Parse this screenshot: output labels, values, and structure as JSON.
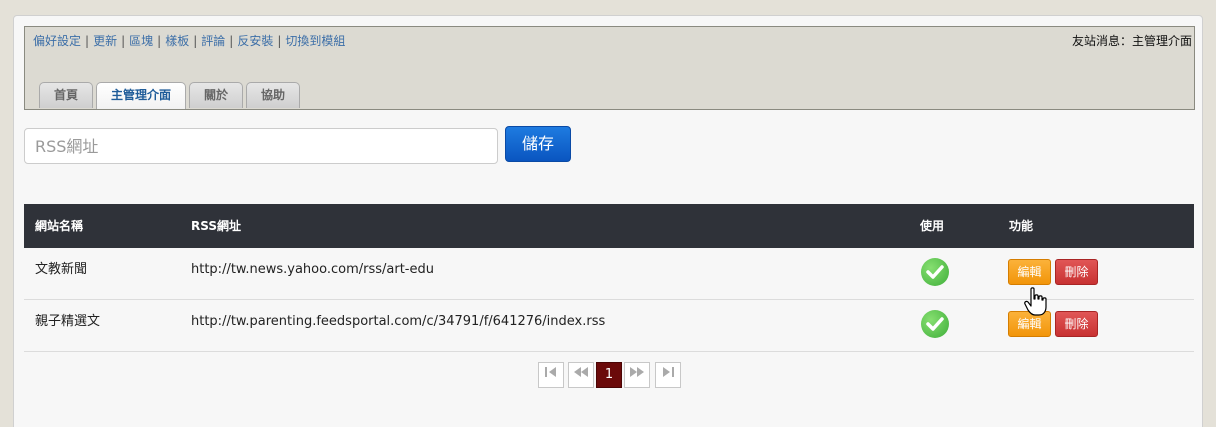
{
  "top_links": [
    "偏好設定",
    "更新",
    "區塊",
    "樣板",
    "評論",
    "反安裝",
    "切換到模組"
  ],
  "friend_msg": "友站消息：主管理介面",
  "tabs": [
    "首頁",
    "主管理介面",
    "關於",
    "協助"
  ],
  "active_tab": "主管理介面",
  "rss_input": {
    "placeholder": "RSS網址",
    "value": ""
  },
  "save_label": "儲存",
  "table": {
    "headers": [
      "網站名稱",
      "RSS網址",
      "使用",
      "功能"
    ],
    "rows": [
      {
        "name": "文教新聞",
        "url": "http://tw.news.yahoo.com/rss/art-edu",
        "enabled": true,
        "edit": "編輯",
        "delete": "刪除"
      },
      {
        "name": "親子精選文",
        "url": "http://tw.parenting.feedsportal.com/c/34791/f/641276/index.rss",
        "enabled": true,
        "edit": "編輯",
        "delete": "刪除"
      }
    ]
  },
  "pager": {
    "current": "1",
    "first_icon": "first-page-icon",
    "prev_icon": "prev-page-icon",
    "next_icon": "next-page-icon",
    "last_icon": "last-page-icon"
  },
  "colors": {
    "header_bg": "#2f3239",
    "save_btn": "#0a55c0",
    "edit_btn": "#f2950a",
    "delete_btn": "#c83232",
    "current_page": "#6b0a0a"
  }
}
